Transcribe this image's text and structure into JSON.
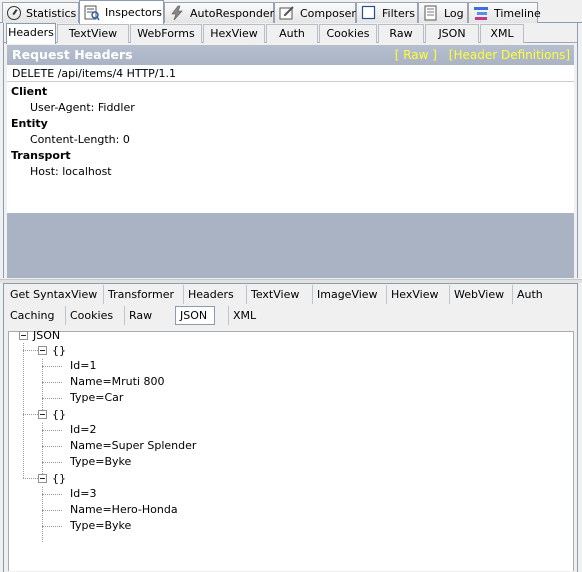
{
  "main_tabs": [
    {
      "label": "Statistics",
      "icon": "stopwatch-icon"
    },
    {
      "label": "Inspectors",
      "icon": "inspector-icon"
    },
    {
      "label": "AutoResponder",
      "icon": "lightning-icon"
    },
    {
      "label": "Composer",
      "icon": "composer-icon"
    },
    {
      "label": "Filters",
      "icon": "checkbox-icon"
    },
    {
      "label": "Log",
      "icon": "log-icon"
    },
    {
      "label": "Timeline",
      "icon": "timeline-icon"
    }
  ],
  "active_main_tab": "Inspectors",
  "request_tabs": [
    "Headers",
    "TextView",
    "WebForms",
    "HexView",
    "Auth",
    "Cookies",
    "Raw",
    "JSON",
    "XML"
  ],
  "active_request_tab": "Headers",
  "request": {
    "section_title": "Request Headers",
    "raw_link": "[ Raw ]",
    "defs_link": "[Header Definitions]",
    "request_line": "DELETE /api/items/4 HTTP/1.1",
    "groups": [
      {
        "name": "Client",
        "headers": [
          "User-Agent: Fiddler"
        ]
      },
      {
        "name": "Entity",
        "headers": [
          "Content-Length: 0"
        ]
      },
      {
        "name": "Transport",
        "headers": [
          "Host: localhost"
        ]
      }
    ]
  },
  "response_tabs_row1": [
    "Get SyntaxView",
    "Transformer",
    "Headers",
    "TextView",
    "ImageView",
    "HexView",
    "WebView",
    "Auth"
  ],
  "response_tabs_row2": [
    "Caching",
    "Cookies",
    "Raw",
    "JSON",
    "XML"
  ],
  "active_response_tab": "JSON",
  "json_tree": {
    "root": "JSON",
    "object_label": "{}",
    "objects": [
      [
        "Id=1",
        "Name=Mruti 800",
        "Type=Car"
      ],
      [
        "Id=2",
        "Name=Super Splender",
        "Type=Byke"
      ],
      [
        "Id=3",
        "Name=Hero-Honda",
        "Type=Byke"
      ]
    ]
  },
  "colors": {
    "section_bar": "#aab3c4",
    "link_yellow": "#ffff33",
    "tab_border": "#8b9bb0"
  }
}
